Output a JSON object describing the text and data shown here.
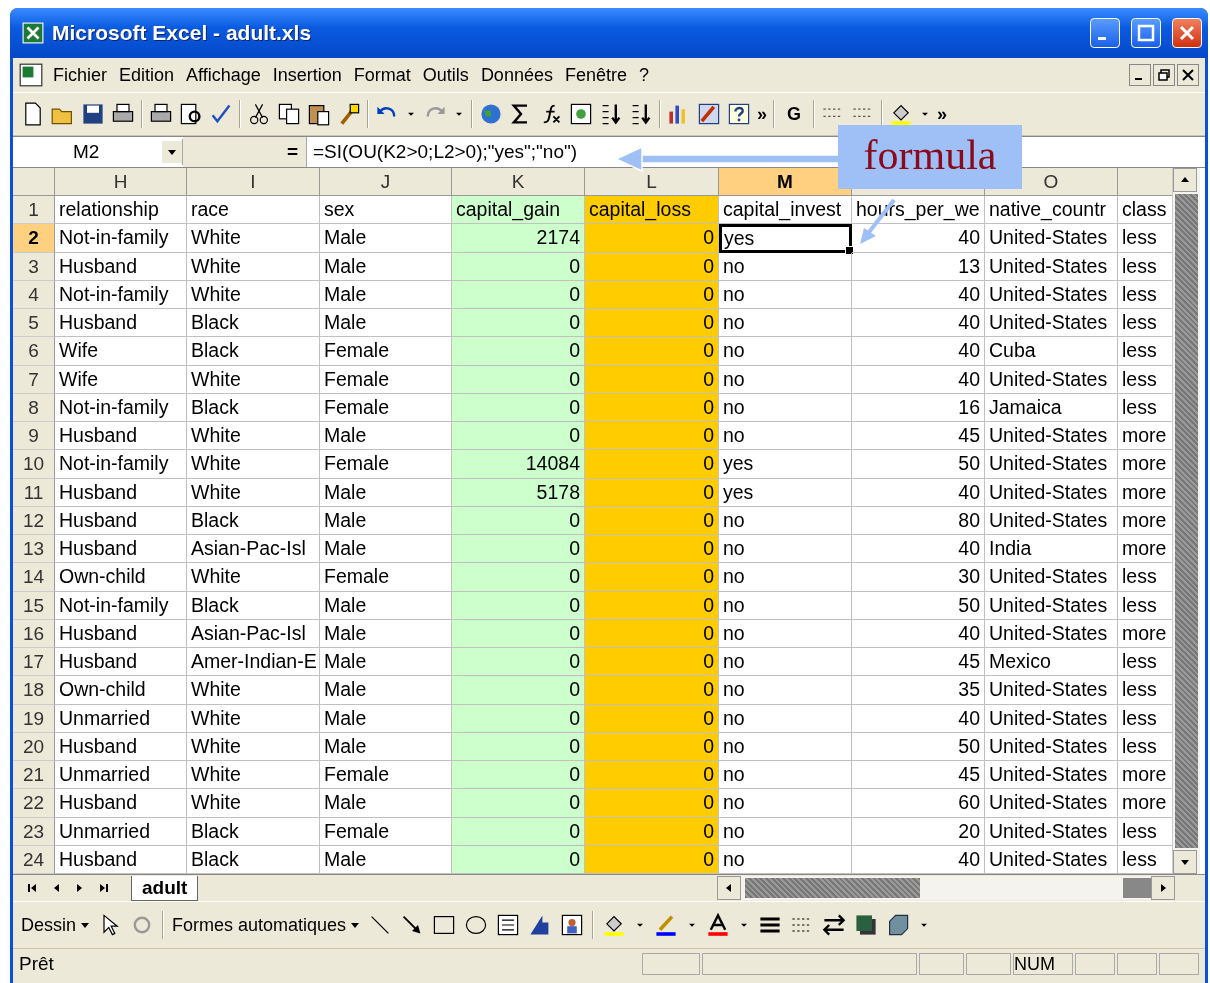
{
  "window": {
    "title": "Microsoft Excel - adult.xls"
  },
  "menu": [
    "Fichier",
    "Edition",
    "Affichage",
    "Insertion",
    "Format",
    "Outils",
    "Données",
    "Fenêtre",
    "?"
  ],
  "toolbar": {
    "bold_button": "G",
    "overflow": [
      "»",
      "»"
    ]
  },
  "formula_bar": {
    "name_box": "M2",
    "equals": "=",
    "formula": "=SI(OU(K2>0;L2>0);\"yes\";\"no\")"
  },
  "callout": {
    "text": "formula"
  },
  "columns": [
    {
      "header": "H",
      "kind": "text",
      "selected": false
    },
    {
      "header": "I",
      "kind": "text",
      "selected": false
    },
    {
      "header": "J",
      "kind": "text",
      "selected": false
    },
    {
      "header": "K",
      "kind": "number",
      "selected": false,
      "color": "#ccffcc"
    },
    {
      "header": "L",
      "kind": "number",
      "selected": false,
      "color": "#ffcc00"
    },
    {
      "header": "M",
      "kind": "text",
      "selected": true
    },
    {
      "kind": "number",
      "selected": false
    },
    {
      "header": "O",
      "kind": "text",
      "selected": false
    },
    {
      "kind": "text",
      "selected": false
    }
  ],
  "rows": [
    {
      "number": "1",
      "selected": false,
      "header": true,
      "cells": [
        "relationship",
        "race",
        "sex",
        "capital_gain",
        "capital_loss",
        "capital_invest",
        "hours_per_we",
        "native_countr",
        "class"
      ]
    },
    {
      "number": "2",
      "selected": true,
      "cells": [
        "Not-in-family",
        "White",
        "Male",
        "2174",
        "0",
        "yes",
        "40",
        "United-States",
        "less"
      ]
    },
    {
      "number": "3",
      "selected": false,
      "cells": [
        "Husband",
        "White",
        "Male",
        "0",
        "0",
        "no",
        "13",
        "United-States",
        "less"
      ]
    },
    {
      "number": "4",
      "selected": false,
      "cells": [
        "Not-in-family",
        "White",
        "Male",
        "0",
        "0",
        "no",
        "40",
        "United-States",
        "less"
      ]
    },
    {
      "number": "5",
      "selected": false,
      "cells": [
        "Husband",
        "Black",
        "Male",
        "0",
        "0",
        "no",
        "40",
        "United-States",
        "less"
      ]
    },
    {
      "number": "6",
      "selected": false,
      "cells": [
        "Wife",
        "Black",
        "Female",
        "0",
        "0",
        "no",
        "40",
        "Cuba",
        "less"
      ]
    },
    {
      "number": "7",
      "selected": false,
      "cells": [
        "Wife",
        "White",
        "Female",
        "0",
        "0",
        "no",
        "40",
        "United-States",
        "less"
      ]
    },
    {
      "number": "8",
      "selected": false,
      "cells": [
        "Not-in-family",
        "Black",
        "Female",
        "0",
        "0",
        "no",
        "16",
        "Jamaica",
        "less"
      ]
    },
    {
      "number": "9",
      "selected": false,
      "cells": [
        "Husband",
        "White",
        "Male",
        "0",
        "0",
        "no",
        "45",
        "United-States",
        "more"
      ]
    },
    {
      "number": "10",
      "selected": false,
      "cells": [
        "Not-in-family",
        "White",
        "Female",
        "14084",
        "0",
        "yes",
        "50",
        "United-States",
        "more"
      ]
    },
    {
      "number": "11",
      "selected": false,
      "cells": [
        "Husband",
        "White",
        "Male",
        "5178",
        "0",
        "yes",
        "40",
        "United-States",
        "more"
      ]
    },
    {
      "number": "12",
      "selected": false,
      "cells": [
        "Husband",
        "Black",
        "Male",
        "0",
        "0",
        "no",
        "80",
        "United-States",
        "more"
      ]
    },
    {
      "number": "13",
      "selected": false,
      "cells": [
        "Husband",
        "Asian-Pac-Isl",
        "Male",
        "0",
        "0",
        "no",
        "40",
        "India",
        "more"
      ]
    },
    {
      "number": "14",
      "selected": false,
      "cells": [
        "Own-child",
        "White",
        "Female",
        "0",
        "0",
        "no",
        "30",
        "United-States",
        "less"
      ]
    },
    {
      "number": "15",
      "selected": false,
      "cells": [
        "Not-in-family",
        "Black",
        "Male",
        "0",
        "0",
        "no",
        "50",
        "United-States",
        "less"
      ]
    },
    {
      "number": "16",
      "selected": false,
      "cells": [
        "Husband",
        "Asian-Pac-Isl",
        "Male",
        "0",
        "0",
        "no",
        "40",
        "United-States",
        "more"
      ]
    },
    {
      "number": "17",
      "selected": false,
      "cells": [
        "Husband",
        "Amer-Indian-E",
        "Male",
        "0",
        "0",
        "no",
        "45",
        "Mexico",
        "less"
      ]
    },
    {
      "number": "18",
      "selected": false,
      "cells": [
        "Own-child",
        "White",
        "Male",
        "0",
        "0",
        "no",
        "35",
        "United-States",
        "less"
      ]
    },
    {
      "number": "19",
      "selected": false,
      "cells": [
        "Unmarried",
        "White",
        "Male",
        "0",
        "0",
        "no",
        "40",
        "United-States",
        "less"
      ]
    },
    {
      "number": "20",
      "selected": false,
      "cells": [
        "Husband",
        "White",
        "Male",
        "0",
        "0",
        "no",
        "50",
        "United-States",
        "less"
      ]
    },
    {
      "number": "21",
      "selected": false,
      "cells": [
        "Unmarried",
        "White",
        "Female",
        "0",
        "0",
        "no",
        "45",
        "United-States",
        "more"
      ]
    },
    {
      "number": "22",
      "selected": false,
      "cells": [
        "Husband",
        "White",
        "Male",
        "0",
        "0",
        "no",
        "60",
        "United-States",
        "more"
      ]
    },
    {
      "number": "23",
      "selected": false,
      "cells": [
        "Unmarried",
        "Black",
        "Female",
        "0",
        "0",
        "no",
        "20",
        "United-States",
        "less"
      ]
    },
    {
      "number": "24",
      "selected": false,
      "cells": [
        "Husband",
        "Black",
        "Male",
        "0",
        "0",
        "no",
        "40",
        "United-States",
        "less"
      ]
    }
  ],
  "sheet_tabs": [
    {
      "label": "adult",
      "selected": true
    }
  ],
  "drawing_toolbar": {
    "draw_menu": "Dessin",
    "autoshapes_menu": "Formes automatiques"
  },
  "status_bar": {
    "status": "Prêt",
    "indicator": "NUM"
  }
}
